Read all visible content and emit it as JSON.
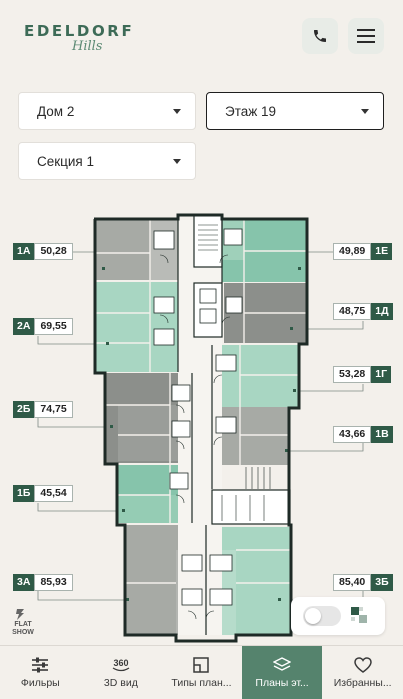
{
  "brand": {
    "name": "EDELDORF",
    "script": "Hills",
    "color": "#3d6b57"
  },
  "header": {
    "phone_icon": "phone-icon",
    "menu_icon": "hamburger-menu-icon"
  },
  "filters": {
    "house": "Дом 2",
    "floor": "Этаж 19",
    "section": "Секция 1"
  },
  "apartments": [
    {
      "code": "1А",
      "area": "50,28"
    },
    {
      "code": "2А",
      "area": "69,55"
    },
    {
      "code": "2Б",
      "area": "74,75"
    },
    {
      "code": "1Б",
      "area": "45,54"
    },
    {
      "code": "3А",
      "area": "85,93"
    },
    {
      "code": "1Е",
      "area": "49,89"
    },
    {
      "code": "1Д",
      "area": "48,75"
    },
    {
      "code": "1Г",
      "area": "53,28"
    },
    {
      "code": "1В",
      "area": "43,66"
    },
    {
      "code": "3Б",
      "area": "85,40"
    }
  ],
  "colors": {
    "available_light": "#a8d6c2",
    "available_teal": "#86c4ab",
    "sold_gray": "#a3a6a1",
    "sold_dark": "#8c8f8b",
    "accent": "#55836d"
  },
  "badge": {
    "line1": "FLAT",
    "line2": "SHOW"
  },
  "nav": [
    {
      "label": "Фильры",
      "icon": "sliders-icon"
    },
    {
      "label": "3D вид",
      "icon": "360-icon"
    },
    {
      "label": "Типы план...",
      "icon": "floorplan-icon"
    },
    {
      "label": "Планы эт...",
      "icon": "layers-icon"
    },
    {
      "label": "Избранны...",
      "icon": "heart-icon"
    }
  ]
}
